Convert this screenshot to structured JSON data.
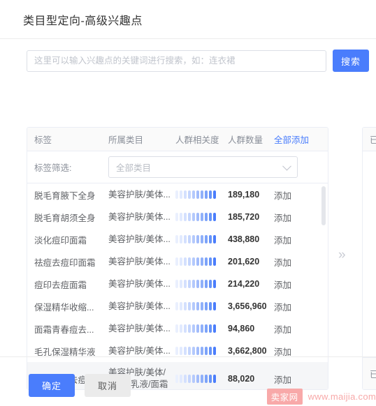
{
  "dialog": {
    "title": "类目型定向-高级兴趣点"
  },
  "search": {
    "placeholder": "这里可以输入兴趣点的关键词进行搜索，如：连衣裙",
    "value": "",
    "button_label": "搜索"
  },
  "table": {
    "headers": {
      "tag": "标签",
      "category": "所属类目",
      "relevance": "人群相关度",
      "count": "人群数量",
      "add_all": "全部添加"
    },
    "filter": {
      "label": "标签筛选:",
      "select_value": "全部类目",
      "chevron_icon": "chevron-down-icon"
    },
    "action_label": "添加",
    "rows": [
      {
        "tag": "脱毛育腋下全身",
        "category": "美容护肤/美体...",
        "relevance": 10,
        "count": "189,180",
        "action": "添加"
      },
      {
        "tag": "脱毛育胡须全身",
        "category": "美容护肤/美体...",
        "relevance": 10,
        "count": "185,720",
        "action": "添加"
      },
      {
        "tag": "淡化痘印面霜",
        "category": "美容护肤/美体...",
        "relevance": 10,
        "count": "438,880",
        "action": "添加"
      },
      {
        "tag": "祛痘去痘印面霜",
        "category": "美容护肤/美体...",
        "relevance": 10,
        "count": "201,620",
        "action": "添加"
      },
      {
        "tag": "痘印去痘面霜",
        "category": "美容护肤/美体...",
        "relevance": 10,
        "count": "214,220",
        "action": "添加"
      },
      {
        "tag": "保湿精华收缩...",
        "category": "美容护肤/美体...",
        "relevance": 10,
        "count": "3,656,960",
        "action": "添加"
      },
      {
        "tag": "面霜青春痘去...",
        "category": "美容护肤/美体...",
        "relevance": 10,
        "count": "94,860",
        "action": "添加"
      },
      {
        "tag": "毛孔保湿精华液",
        "category": "美容护肤/美体...",
        "relevance": 10,
        "count": "3,662,800",
        "action": "添加"
      },
      {
        "tag": "修护面霜去痘印",
        "category": "美容护肤/美体/\n精油_乳液/面霜",
        "relevance": 10,
        "count": "88,020",
        "action": "添加",
        "tall": true,
        "hover": true
      }
    ]
  },
  "collapse": {
    "icon": "chevrons-right-icon",
    "label": "»"
  },
  "right_panel": {
    "header_text": "已",
    "footer_text": "已"
  },
  "footer": {
    "confirm_label": "确定",
    "cancel_label": "取消"
  },
  "watermark": {
    "badge": "卖家网",
    "url": "www.maijia.com"
  },
  "colors": {
    "primary": "#4a7dfc",
    "bar_active": "#4a7dfc",
    "bar_inactive": "#e8eefe",
    "watermark": "#f8a9a9"
  }
}
